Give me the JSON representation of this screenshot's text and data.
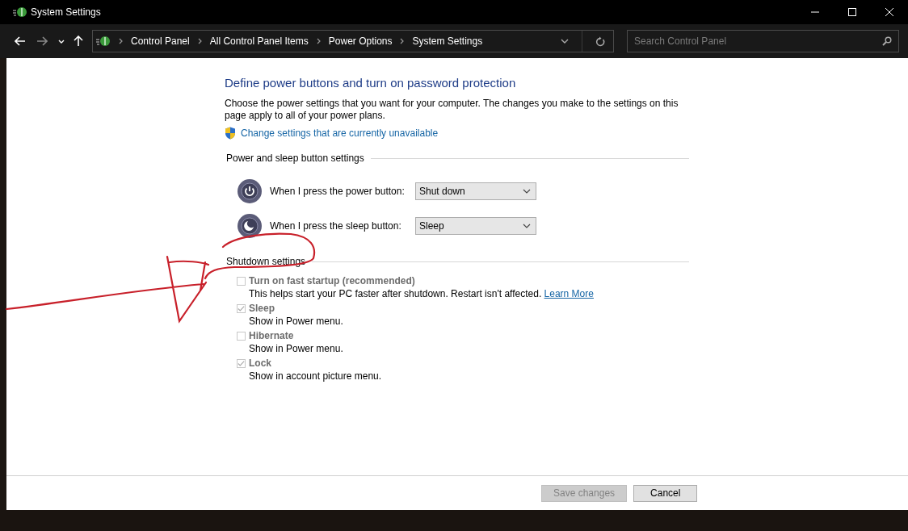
{
  "window": {
    "title": "System Settings"
  },
  "navigation": {
    "breadcrumbs": [
      "Control Panel",
      "All Control Panel Items",
      "Power Options",
      "System Settings"
    ],
    "search": {
      "placeholder": "Search Control Panel"
    }
  },
  "page": {
    "heading": "Define power buttons and turn on password protection",
    "description": "Choose the power settings that you want for your computer. The changes you make to the settings on this page apply to all of your power plans.",
    "admin_link": "Change settings that are currently unavailable"
  },
  "button_settings": {
    "title": "Power and sleep button settings",
    "rows": [
      {
        "kind": "power",
        "label": "When I press the power button:",
        "value": "Shut down"
      },
      {
        "kind": "sleep",
        "label": "When I press the sleep button:",
        "value": "Sleep"
      }
    ]
  },
  "shutdown_settings": {
    "title": "Shutdown settings",
    "options": [
      {
        "label": "Turn on fast startup (recommended)",
        "description": "This helps start your PC faster after shutdown. Restart isn't affected.",
        "link": "Learn More",
        "checked": false,
        "disabled": true
      },
      {
        "label": "Sleep",
        "description": "Show in Power menu.",
        "checked": true,
        "disabled": true
      },
      {
        "label": "Hibernate",
        "description": "Show in Power menu.",
        "checked": false,
        "disabled": true
      },
      {
        "label": "Lock",
        "description": "Show in account picture menu.",
        "checked": true,
        "disabled": true
      }
    ]
  },
  "buttons": [
    {
      "label": "Save changes",
      "disabled": true
    },
    {
      "label": "Cancel",
      "disabled": false
    }
  ]
}
